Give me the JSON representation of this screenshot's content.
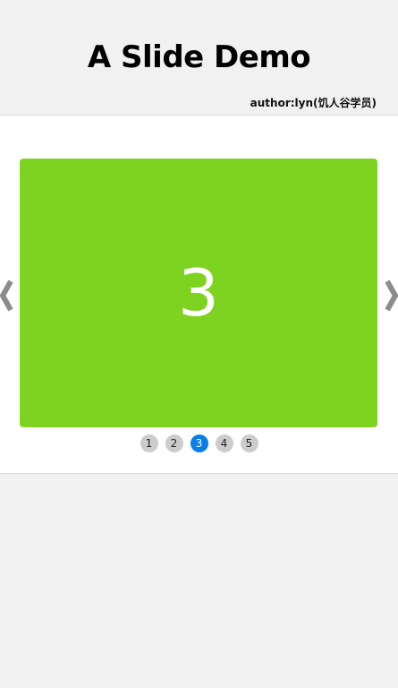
{
  "header": {
    "title": "A Slide Demo",
    "author": "author:lyn(饥人谷学员)"
  },
  "carousel": {
    "current_slide_label": "3",
    "current_index": 3,
    "slide_color": "#7ed321",
    "active_dot_color": "#0a7ee8",
    "prev_icon": "chevron-left-icon",
    "next_icon": "chevron-right-icon",
    "dots": [
      "1",
      "2",
      "3",
      "4",
      "5"
    ]
  }
}
